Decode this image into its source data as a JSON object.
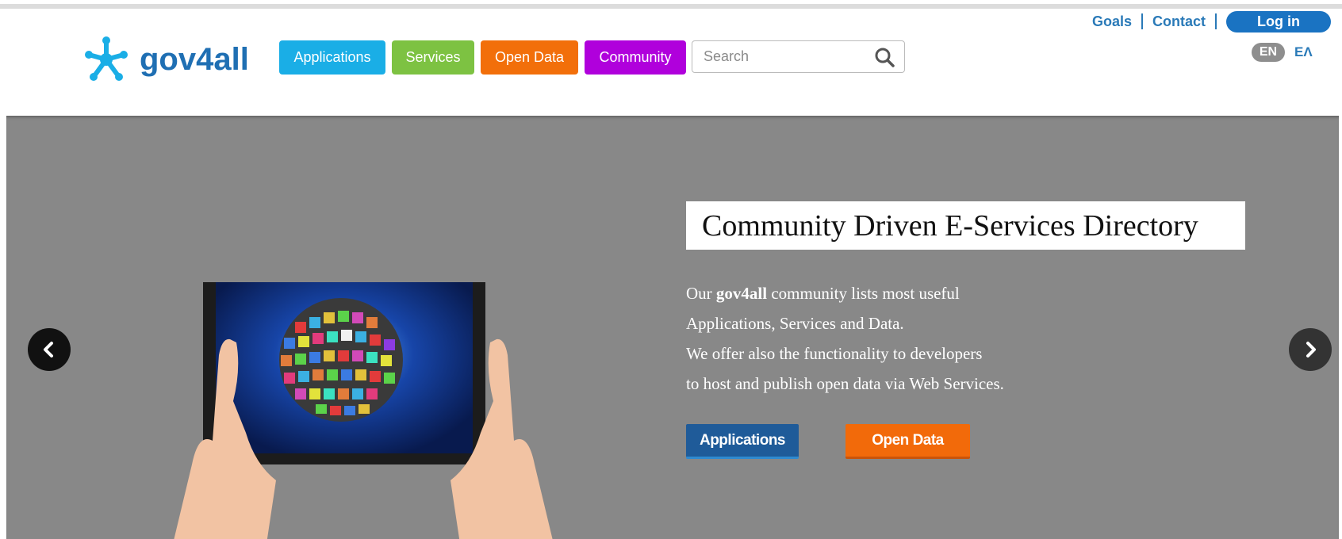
{
  "header": {
    "logo_text": "gov4all",
    "nav": [
      {
        "label": "Applications",
        "color": "#1aaee6"
      },
      {
        "label": "Services",
        "color": "#7dc242"
      },
      {
        "label": "Open Data",
        "color": "#f26f0a"
      },
      {
        "label": "Community",
        "color": "#b000dc"
      }
    ],
    "search": {
      "placeholder": "Search",
      "value": ""
    },
    "toplinks": {
      "goals": "Goals",
      "contact": "Contact",
      "login": "Log in"
    },
    "lang": {
      "en": "EN",
      "el": "ΕΛ"
    }
  },
  "hero": {
    "title": "Community Driven E-Services Directory",
    "text_line1_pre": "Our ",
    "text_line1_brand": "gov4all",
    "text_line1_post": " community lists most useful",
    "text_line2": "Applications, Services and Data.",
    "text_line3": "We offer also the functionality to developers",
    "text_line4": "to host and publish open data via Web Services.",
    "cta_apps": "Applications",
    "cta_opendata": "Open Data"
  },
  "colors": {
    "brand_blue": "#1f6fb3",
    "hero_bg": "#888888",
    "login_blue": "#1a73c2"
  },
  "icons": {
    "logo": "network-star-icon",
    "search": "search-icon",
    "prev": "chevron-left-icon",
    "next": "chevron-right-icon"
  }
}
